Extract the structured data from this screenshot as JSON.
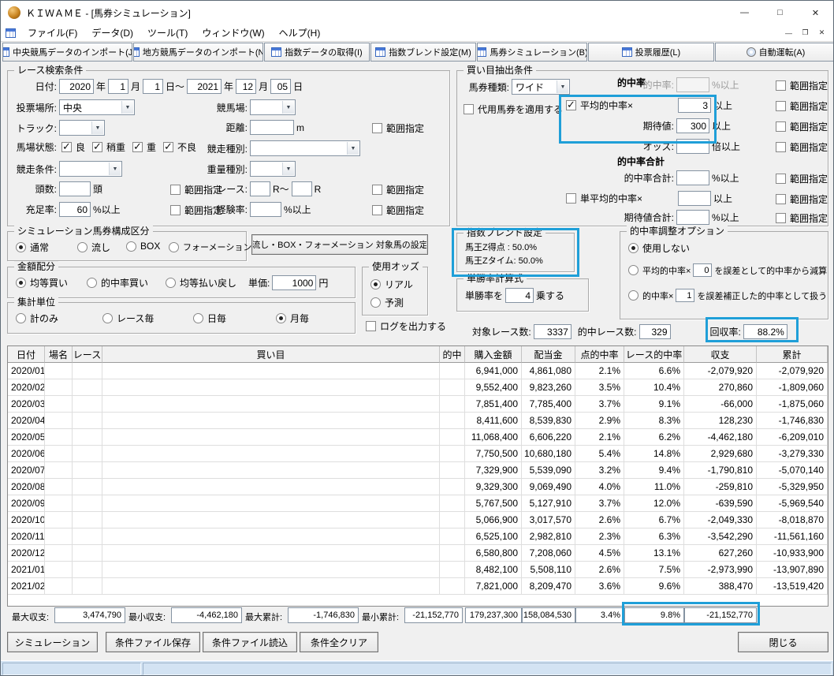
{
  "colors": {
    "highlight": "#1f9fd8",
    "window_bg": "#f0f0f0",
    "titlebar_bg": "#ffffff",
    "statusbar_bg": "#d3e3f3"
  },
  "icons": {
    "dropdown": "▼",
    "minimize": "—",
    "maximize": "□",
    "restore": "❐",
    "close": "✕",
    "check": "✓"
  },
  "titlebar": {
    "title": "ＫＩＷＡＭＥ - [馬券シミュレーション]"
  },
  "menubar": {
    "items": [
      "ファイル(F)",
      "データ(D)",
      "ツール(T)",
      "ウィンドウ(W)",
      "ヘルプ(H)"
    ]
  },
  "toolbar": {
    "buttons": [
      "中央競馬データのインポート(J)",
      "地方競馬データのインポート(N)",
      "指数データの取得(I)",
      "指数ブレンド設定(M)",
      "馬券シミュレーション(B)",
      "投票履歴(L)",
      "自動運転(A)"
    ]
  },
  "labels": {
    "range": "範囲指定"
  },
  "search": {
    "title": "レース検索条件",
    "date": {
      "label": "日付:",
      "from_year": "2020",
      "from_month": "1",
      "from_day": "1",
      "to_year": "2021",
      "to_month": "12",
      "to_day": "05",
      "y": "年",
      "m": "月",
      "d": "日",
      "d_to": "日～"
    },
    "place": {
      "label": "投票場所:",
      "value": "中央"
    },
    "course": {
      "label": "競馬場:"
    },
    "track": {
      "label": "トラック:"
    },
    "distance": {
      "label": "距離:",
      "unit": "m"
    },
    "condition": {
      "label": "馬場状態:",
      "options": [
        "良",
        "稍重",
        "重",
        "不良"
      ]
    },
    "race_type": {
      "label": "競走種別:"
    },
    "race_cond": {
      "label": "競走条件:"
    },
    "weight_type": {
      "label": "重量種別:"
    },
    "heads": {
      "label": "頭数:",
      "unit": "頭"
    },
    "race_no": {
      "label": "レース:",
      "unit1": "R～",
      "unit2": "R"
    },
    "fill_rate": {
      "label": "充足率:",
      "value": "60",
      "unit": "%以上"
    },
    "exp_rate": {
      "label": "経験率:",
      "unit": "%以上"
    }
  },
  "pick": {
    "title": "買い目抽出条件",
    "ticket_type": {
      "label": "馬券種類:",
      "value": "ワイド"
    },
    "substitute_label": "代用馬券を適用する",
    "hit_header": "的中率",
    "hit": {
      "label": "的中率:",
      "unit": "%以上"
    },
    "avg_hit": {
      "label": "平均的中率×",
      "value": "3",
      "unit": "以上"
    },
    "expect": {
      "label": "期待値:",
      "value": "300",
      "unit": "以上"
    },
    "odds": {
      "label": "オッズ:",
      "unit": "倍以上"
    },
    "sum_header": "的中率合計",
    "hit_sum": {
      "label": "的中率合計:",
      "unit": "%以上"
    },
    "single_avg": {
      "label": "単平均的中率×",
      "unit": "以上"
    },
    "expect_sum": {
      "label": "期待値合計:",
      "unit": "%以上"
    }
  },
  "sim_type": {
    "title": "シミュレーション馬券構成区分",
    "options": [
      "通常",
      "流し",
      "BOX",
      "フォーメーション"
    ],
    "selected": "通常"
  },
  "target_button": "流し・BOX・フォーメーション 対象馬の設定",
  "blend": {
    "title": "指数ブレンド設定",
    "line1": "馬王Z得点 : 50.0%",
    "line2": "馬王Zタイム: 50.0%"
  },
  "adjust": {
    "title": "的中率調整オプション",
    "opt_none": "使用しない",
    "opt_avg": {
      "pre": "平均的中率×",
      "value": "0",
      "post": "を誤差として的中率から減算"
    },
    "opt_hit": {
      "pre": "的中率×",
      "value": "1",
      "post": "を誤差補正した的中率として扱う"
    },
    "selected": "使用しない"
  },
  "amount": {
    "title": "金額配分",
    "options": [
      "均等買い",
      "的中率買い",
      "均等払い戻し"
    ],
    "selected": "均等買い",
    "unit_price": {
      "label": "単価:",
      "value": "1000",
      "unit": "円"
    }
  },
  "odds_use": {
    "title": "使用オッズ",
    "options": [
      "リアル",
      "予測"
    ],
    "selected": "リアル"
  },
  "win_calc": {
    "title": "単勝率計算式",
    "pre": "単勝率を",
    "value": "4",
    "post": "乗する"
  },
  "aggregate": {
    "title": "集計単位",
    "options": [
      "計のみ",
      "レース毎",
      "日毎",
      "月毎"
    ],
    "selected": "月毎"
  },
  "log_label": "ログを出力する",
  "stats": {
    "target_label": "対象レース数:",
    "target_value": "3337",
    "hit_label": "的中レース数:",
    "hit_value": "329",
    "recovery_label": "回収率:",
    "recovery_value": "88.2%"
  },
  "table": {
    "headers": [
      "日付",
      "場名",
      "レース",
      "買い目",
      "的中",
      "購入金額",
      "配当金",
      "点的中率",
      "レース的中率",
      "収支",
      "累計"
    ],
    "rows": [
      {
        "date": "2020/01",
        "purchase": "6,941,000",
        "payout": "4,861,080",
        "point_hit": "2.1%",
        "race_hit": "6.6%",
        "balance": "-2,079,920",
        "cumulative": "-2,079,920"
      },
      {
        "date": "2020/02",
        "purchase": "9,552,400",
        "payout": "9,823,260",
        "point_hit": "3.5%",
        "race_hit": "10.4%",
        "balance": "270,860",
        "cumulative": "-1,809,060"
      },
      {
        "date": "2020/03",
        "purchase": "7,851,400",
        "payout": "7,785,400",
        "point_hit": "3.7%",
        "race_hit": "9.1%",
        "balance": "-66,000",
        "cumulative": "-1,875,060"
      },
      {
        "date": "2020/04",
        "purchase": "8,411,600",
        "payout": "8,539,830",
        "point_hit": "2.9%",
        "race_hit": "8.3%",
        "balance": "128,230",
        "cumulative": "-1,746,830"
      },
      {
        "date": "2020/05",
        "purchase": "11,068,400",
        "payout": "6,606,220",
        "point_hit": "2.1%",
        "race_hit": "6.2%",
        "balance": "-4,462,180",
        "cumulative": "-6,209,010"
      },
      {
        "date": "2020/06",
        "purchase": "7,750,500",
        "payout": "10,680,180",
        "point_hit": "5.4%",
        "race_hit": "14.8%",
        "balance": "2,929,680",
        "cumulative": "-3,279,330"
      },
      {
        "date": "2020/07",
        "purchase": "7,329,900",
        "payout": "5,539,090",
        "point_hit": "3.2%",
        "race_hit": "9.4%",
        "balance": "-1,790,810",
        "cumulative": "-5,070,140"
      },
      {
        "date": "2020/08",
        "purchase": "9,329,300",
        "payout": "9,069,490",
        "point_hit": "4.0%",
        "race_hit": "11.0%",
        "balance": "-259,810",
        "cumulative": "-5,329,950"
      },
      {
        "date": "2020/09",
        "purchase": "5,767,500",
        "payout": "5,127,910",
        "point_hit": "3.7%",
        "race_hit": "12.0%",
        "balance": "-639,590",
        "cumulative": "-5,969,540"
      },
      {
        "date": "2020/10",
        "purchase": "5,066,900",
        "payout": "3,017,570",
        "point_hit": "2.6%",
        "race_hit": "6.7%",
        "balance": "-2,049,330",
        "cumulative": "-8,018,870"
      },
      {
        "date": "2020/11",
        "purchase": "6,525,100",
        "payout": "2,982,810",
        "point_hit": "2.3%",
        "race_hit": "6.3%",
        "balance": "-3,542,290",
        "cumulative": "-11,561,160"
      },
      {
        "date": "2020/12",
        "purchase": "6,580,800",
        "payout": "7,208,060",
        "point_hit": "4.5%",
        "race_hit": "13.1%",
        "balance": "627,260",
        "cumulative": "-10,933,900"
      },
      {
        "date": "2021/01",
        "purchase": "8,482,100",
        "payout": "5,508,110",
        "point_hit": "2.6%",
        "race_hit": "7.5%",
        "balance": "-2,973,990",
        "cumulative": "-13,907,890"
      },
      {
        "date": "2021/02",
        "purchase": "7,821,000",
        "payout": "8,209,470",
        "point_hit": "3.6%",
        "race_hit": "9.6%",
        "balance": "388,470",
        "cumulative": "-13,519,420"
      }
    ]
  },
  "summary": {
    "max_balance": {
      "label": "最大収支:",
      "value": "3,474,790"
    },
    "min_balance": {
      "label": "最小収支:",
      "value": "-4,462,180"
    },
    "max_cumulative": {
      "label": "最大累計:",
      "value": "-1,746,830"
    },
    "min_cumulative": {
      "label": "最小累計:",
      "value": "-21,152,770"
    },
    "total_purchase": "179,237,300",
    "total_payout": "158,084,530",
    "total_point_hit": "3.4%",
    "total_race_hit": "9.8%",
    "total_balance": "-21,152,770"
  },
  "bottom_buttons": [
    "シミュレーション",
    "条件ファイル保存",
    "条件ファイル読込",
    "条件全クリア",
    "閉じる"
  ]
}
